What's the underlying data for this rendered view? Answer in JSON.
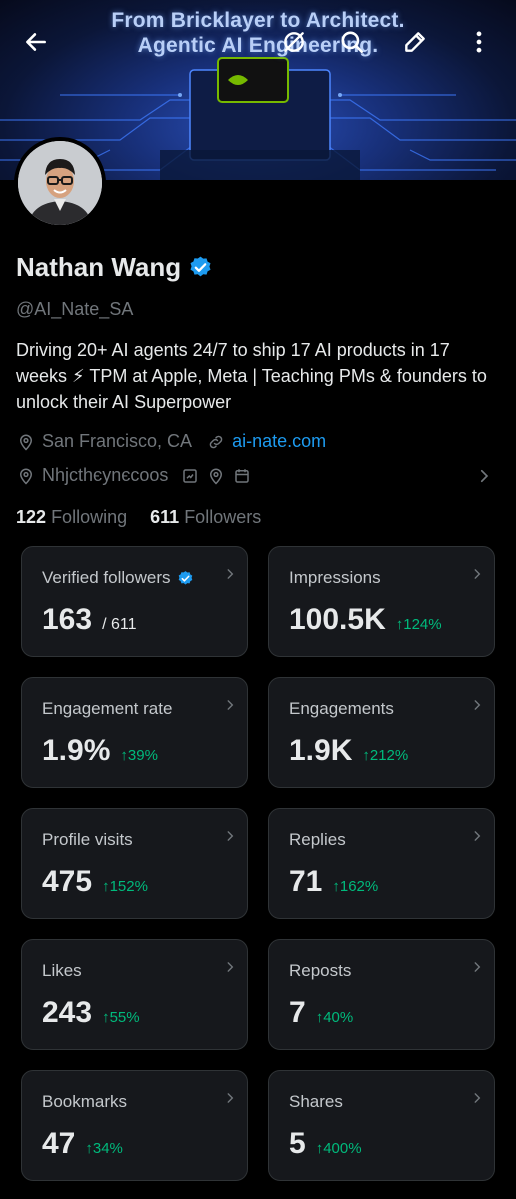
{
  "banner": {
    "line1": "From Bricklayer to Architect.",
    "line2": "Agentic AI Engineering.",
    "chip_text": "NVIDIA"
  },
  "profile": {
    "name": "Nathan Wang",
    "handle": "@AI_Nate_SA",
    "bio": "Driving 20+ AI agents 24/7 to ship 17 AI products in 17 weeks ⚡ TPM at Apple, Meta | Teaching PMs & founders to unlock their AI Superpower",
    "location": "San Francisco, CA",
    "website": "ai-nate.com",
    "meta_line": "Nhjcthєynєcoos",
    "following_count": "122",
    "following_label": "Following",
    "followers_count": "611",
    "followers_label": "Followers"
  },
  "stats": [
    {
      "label": "Verified followers",
      "value": "163",
      "sub": "/ 611",
      "delta": "",
      "verified": true
    },
    {
      "label": "Impressions",
      "value": "100.5K",
      "sub": "",
      "delta": "↑124%"
    },
    {
      "label": "Engagement rate",
      "value": "1.9%",
      "sub": "",
      "delta": "↑39%"
    },
    {
      "label": "Engagements",
      "value": "1.9K",
      "sub": "",
      "delta": "↑212%"
    },
    {
      "label": "Profile visits",
      "value": "475",
      "sub": "",
      "delta": "↑152%"
    },
    {
      "label": "Replies",
      "value": "71",
      "sub": "",
      "delta": "↑162%"
    },
    {
      "label": "Likes",
      "value": "243",
      "sub": "",
      "delta": "↑55%"
    },
    {
      "label": "Reposts",
      "value": "7",
      "sub": "",
      "delta": "↑40%"
    },
    {
      "label": "Bookmarks",
      "value": "47",
      "sub": "",
      "delta": "↑34%"
    },
    {
      "label": "Shares",
      "value": "5",
      "sub": "",
      "delta": "↑400%"
    }
  ],
  "colors": {
    "background": "#000000",
    "card": "#16181c",
    "accent": "#1d9bf0",
    "positive": "#00ba7c",
    "muted": "#71767b"
  },
  "icons": {
    "back": "back-arrow-icon",
    "grok": "grok-icon",
    "search": "search-icon",
    "edit": "edit-icon",
    "more": "more-vertical-icon"
  }
}
